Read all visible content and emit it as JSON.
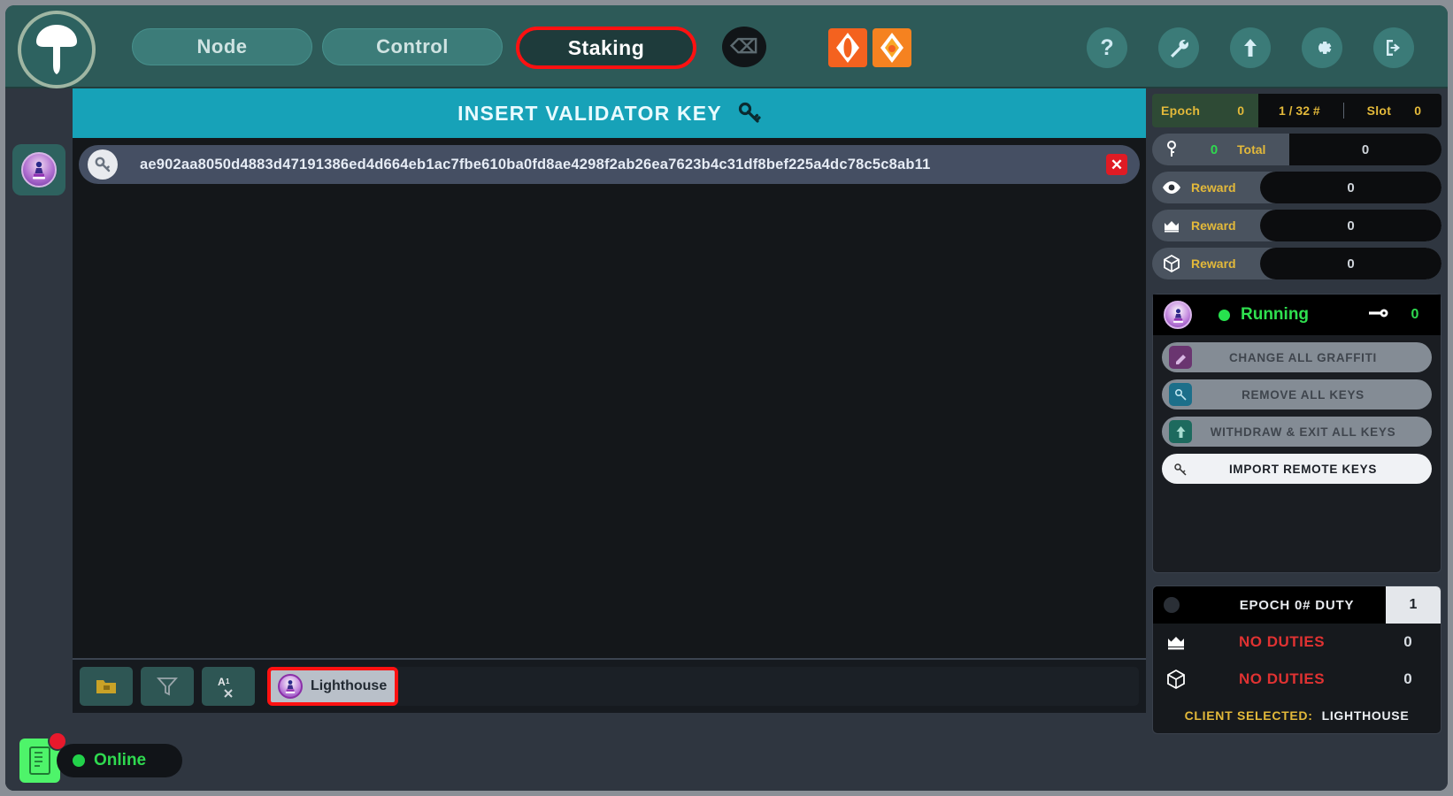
{
  "topnav": {
    "logo_icon": "mushroom-logo-icon",
    "tabs": [
      {
        "id": "node",
        "label": "Node",
        "active": false
      },
      {
        "id": "control",
        "label": "Control",
        "active": false
      },
      {
        "id": "staking",
        "label": "Staking",
        "active": true
      }
    ],
    "terminal_glyph": "⌫",
    "network_icons": [
      "ethereum-diamond-icon",
      "ethereum-spiral-icon"
    ],
    "right_icons": [
      {
        "id": "help",
        "name": "help-icon",
        "glyph": "?"
      },
      {
        "id": "tool",
        "name": "wrench-icon"
      },
      {
        "id": "update",
        "name": "upload-arrow-icon"
      },
      {
        "id": "gear",
        "name": "gear-icon"
      },
      {
        "id": "exit",
        "name": "logout-icon"
      }
    ]
  },
  "leftrail": {
    "item_icon": "lighthouse-client-icon"
  },
  "main": {
    "header_title": "INSERT VALIDATOR KEY",
    "header_icon": "key-icon",
    "keys": [
      {
        "pubkey": "ae902aa8050d4883d47191386ed4d664eb1ac7fbe610ba0fd8ae4298f2ab26ea7623b4c31df8bef225a4dc78c5c8ab11",
        "remove_glyph": "✕"
      }
    ],
    "bottom_tools": [
      {
        "id": "folder",
        "name": "folder-icon"
      },
      {
        "id": "filter",
        "name": "funnel-filter-icon"
      },
      {
        "id": "sort",
        "name": "sort-alpha-icon"
      }
    ],
    "selected_client": "Lighthouse"
  },
  "status": {
    "online_label": "Online",
    "doc_icon": "log-file-icon",
    "badge_visible": true
  },
  "right": {
    "epoch": {
      "label": "Epoch",
      "value": "0",
      "slot_progress": "1 / 32 #",
      "slot_label": "Slot",
      "slot_value": "0"
    },
    "stats": [
      {
        "id": "total",
        "icon": "key-icon",
        "count": "0",
        "label": "Total",
        "value": "0"
      },
      {
        "id": "attestation-reward",
        "icon": "eye-icon",
        "label": "Reward",
        "value": "0"
      },
      {
        "id": "sync-reward",
        "icon": "crown-icon",
        "label": "Reward",
        "value": "0"
      },
      {
        "id": "proposal-reward",
        "icon": "cube-icon",
        "label": "Reward",
        "value": "0"
      }
    ],
    "validator": {
      "logo_icon": "lighthouse-client-icon",
      "status": "Running",
      "key_count": "0",
      "actions": [
        {
          "id": "graffiti",
          "label": "CHANGE ALL GRAFFITI",
          "icon": "graffiti-icon",
          "enabled": false
        },
        {
          "id": "remove",
          "label": "REMOVE ALL KEYS",
          "icon": "remove-key-icon",
          "enabled": false
        },
        {
          "id": "withdraw",
          "label": "WITHDRAW & EXIT ALL KEYS",
          "icon": "withdraw-icon",
          "enabled": false
        },
        {
          "id": "import",
          "label": "IMPORT REMOTE KEYS",
          "icon": "import-icon",
          "enabled": true
        }
      ]
    },
    "duty": {
      "title": "EPOCH 0# DUTY",
      "number": "1",
      "rows": [
        {
          "id": "attestation",
          "icon": "crown-icon",
          "text": "NO DUTIES",
          "value": "0"
        },
        {
          "id": "proposal",
          "icon": "cube-icon",
          "text": "NO DUTIES",
          "value": "0"
        }
      ],
      "client_selected_label": "CLIENT SELECTED:",
      "client_selected_value": "LIGHTHOUSE"
    }
  },
  "colors": {
    "teal": "#2d5a58",
    "cyan_header": "#17a2b8",
    "accent_red": "#ff1111",
    "gold": "#e3b93a",
    "green": "#2fd94f",
    "duty_red": "#e03232"
  }
}
